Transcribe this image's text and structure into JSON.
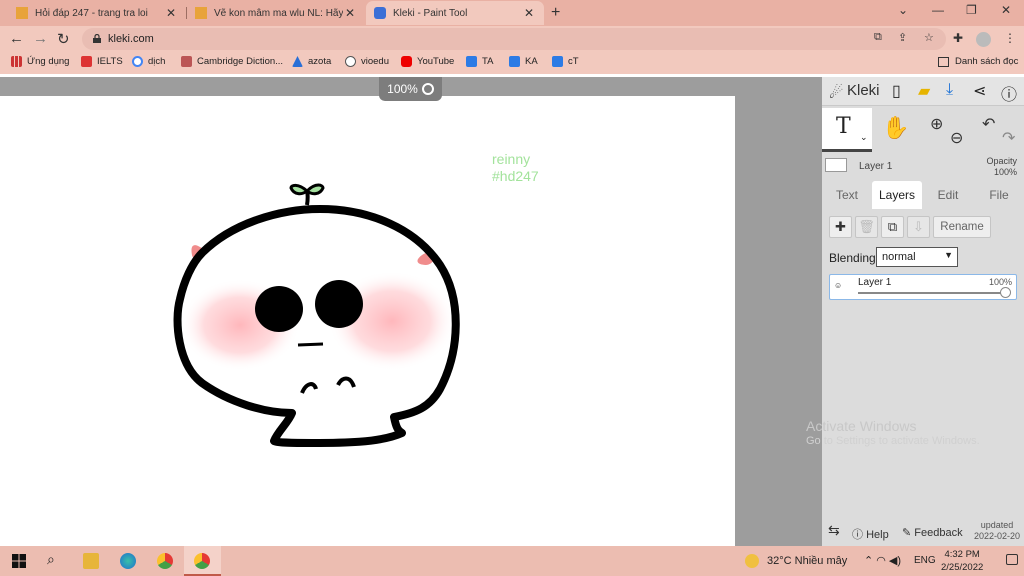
{
  "browser": {
    "tabs": [
      {
        "title": "Hỏi đáp 247 - trang tra loi",
        "active": false
      },
      {
        "title": "Vẽ kon mâm ma wlu NL: Hãy viế",
        "active": false
      },
      {
        "title": "Kleki - Paint Tool",
        "active": true
      }
    ],
    "new_tab": "+",
    "url": "kleki.com",
    "bookmarks": [
      "Ứng dụng",
      "IELTS",
      "dịch",
      "Cambridge Diction...",
      "azota",
      "vioedu",
      "YouTube",
      "TA",
      "KA",
      "cT"
    ],
    "reading_list": "Danh sách đọc"
  },
  "canvas": {
    "zoom": "100%",
    "signature": [
      "reinny",
      "#hd247"
    ],
    "watermark": [
      "Activate Windows",
      "Go to Settings to activate Windows."
    ]
  },
  "kleki": {
    "logo": "Kleki",
    "current_tool": "T",
    "layer_name": "Layer 1",
    "opacity_label": "Opacity",
    "opacity_value": "100%",
    "tabs": [
      "Text",
      "Layers",
      "Edit",
      "File"
    ],
    "active_tab": "Layers",
    "rename_label": "Rename",
    "blending_label": "Blending",
    "blending_value": "normal",
    "layers": [
      {
        "name": "Layer 1",
        "opacity": "100%",
        "opacity_fraction": 1.0
      }
    ],
    "footer": {
      "help": "Help",
      "feedback": "Feedback",
      "updated_label": "updated",
      "updated_date": "2022-02-20"
    }
  },
  "taskbar": {
    "weather_temp": "32°C",
    "weather_text": "Nhiều mây",
    "language": "ENG",
    "time": "4:32 PM",
    "date": "2/25/2022"
  },
  "colors": {
    "tab_strip": "#e9b1a4",
    "toolbar": "#f2c9be",
    "workspace": "#9d9d9d",
    "panel": "#dcdcdc",
    "signature": "#a3e39c",
    "blush": "#ffb3b8",
    "taskbar": "#ecbdb1"
  }
}
